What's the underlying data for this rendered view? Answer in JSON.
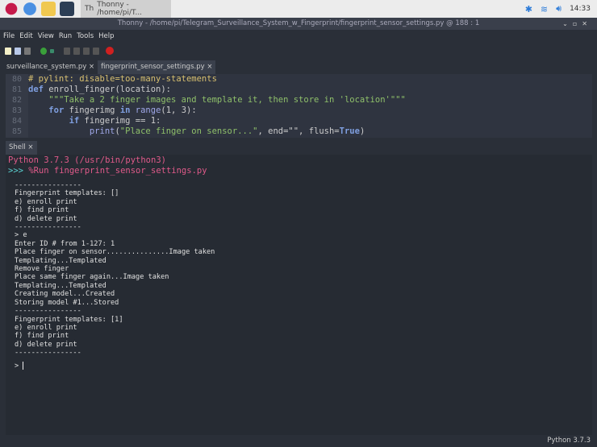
{
  "taskbar": {
    "task_label": "Thonny - /home/pi/T...",
    "clock": "14:33"
  },
  "window": {
    "title": "Thonny  -  /home/pi/Telegram_Surveillance_System_w_Fingerprint/fingerprint_sensor_settings.py  @  188 : 1"
  },
  "menu": [
    "File",
    "Edit",
    "View",
    "Run",
    "Tools",
    "Help"
  ],
  "tabs": [
    {
      "label": "surveillance_system.py ×"
    },
    {
      "label": "fingerprint_sensor_settings.py ×"
    }
  ],
  "editor": {
    "lines": [
      {
        "n": "80",
        "text": "# pylint: disable=too-many-statements"
      },
      {
        "n": "81"
      },
      {
        "n": "82"
      },
      {
        "n": "83"
      },
      {
        "n": "84"
      },
      {
        "n": "85"
      }
    ],
    "l81": {
      "kw": "def",
      "rest": " enroll_finger(location):"
    },
    "l82": {
      "str": "\"\"\"Take a 2 finger images and template it, then store in 'location'\"\"\""
    },
    "l83": {
      "kw": "for",
      "a": " fingerimg ",
      "kw2": "in",
      "bi": " range",
      "rest": "(1, 3):"
    },
    "l84": {
      "kw": "if",
      "rest": " fingerimg == 1:"
    },
    "l85": {
      "bi": "print",
      "p1": "(",
      "str": "\"Place finger on sensor...\"",
      "rest": ", end=\"\", flush=",
      "kw": "True",
      "end": ")"
    }
  },
  "shell": {
    "tab_label": "Shell ×",
    "version_line": "Python 3.7.3 (/usr/bin/python3)",
    "prompt": ">>>",
    "command": " %Run fingerprint_sensor_settings.py",
    "output": "----------------\nFingerprint templates: []\ne) enroll print\nf) find print\nd) delete print\n----------------\n> e\nEnter ID # from 1-127: 1\nPlace finger on sensor...............Image taken\nTemplating...Templated\nRemove finger\nPlace same finger again...Image taken\nTemplating...Templated\nCreating model...Created\nStoring model #1...Stored\n----------------\nFingerprint templates: [1]\ne) enroll print\nf) find print\nd) delete print\n----------------",
    "input_prompt": "> "
  },
  "status": {
    "python_version": "Python 3.7.3"
  }
}
